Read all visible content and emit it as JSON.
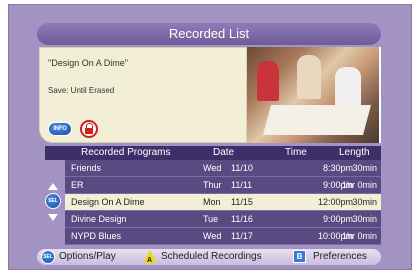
{
  "title": "Recorded List",
  "info_panel": {
    "program_title": "\"Design On A Dime\"",
    "save_info": "Save: Until Erased",
    "info_icon_label": "INFO",
    "lock_icon": "lock-icon"
  },
  "list": {
    "headers": {
      "name": "Recorded Programs",
      "date": "Date",
      "time": "Time",
      "length": "Length"
    },
    "rows": [
      {
        "name": "Friends",
        "day": "Wed",
        "date": "11/10",
        "time": "8:30pm",
        "length": "30min",
        "selected": false
      },
      {
        "name": "ER",
        "day": "Thur",
        "date": "11/11",
        "time": "9:00pm",
        "length": "1hr  0min",
        "selected": false
      },
      {
        "name": "Design On A Dime",
        "day": "Mon",
        "date": "11/15",
        "time": "12:00pm",
        "length": "30min",
        "selected": true
      },
      {
        "name": "Divine Design",
        "day": "Tue",
        "date": "11/16",
        "time": "9:00pm",
        "length": "30min",
        "selected": false
      },
      {
        "name": "NYPD Blues",
        "day": "Wed",
        "date": "11/17",
        "time": "10:00pm",
        "length": "1hr  0min",
        "selected": false
      }
    ],
    "sel_icon_label": "SEL"
  },
  "bottom_bar": {
    "options_label": "Options/Play",
    "scheduled_label": "Scheduled Recordings",
    "preferences_label": "Preferences",
    "sel_icon_label": "SEL",
    "a_icon_label": "A",
    "b_icon_label": "B"
  },
  "colors": {
    "background": "#a393c2",
    "title_bar": "#7a66a8",
    "info_panel": "#f2efd6",
    "list_row": "#5a4a82",
    "header_row": "#3e2f6a",
    "selected_row": "#f2efd6"
  }
}
